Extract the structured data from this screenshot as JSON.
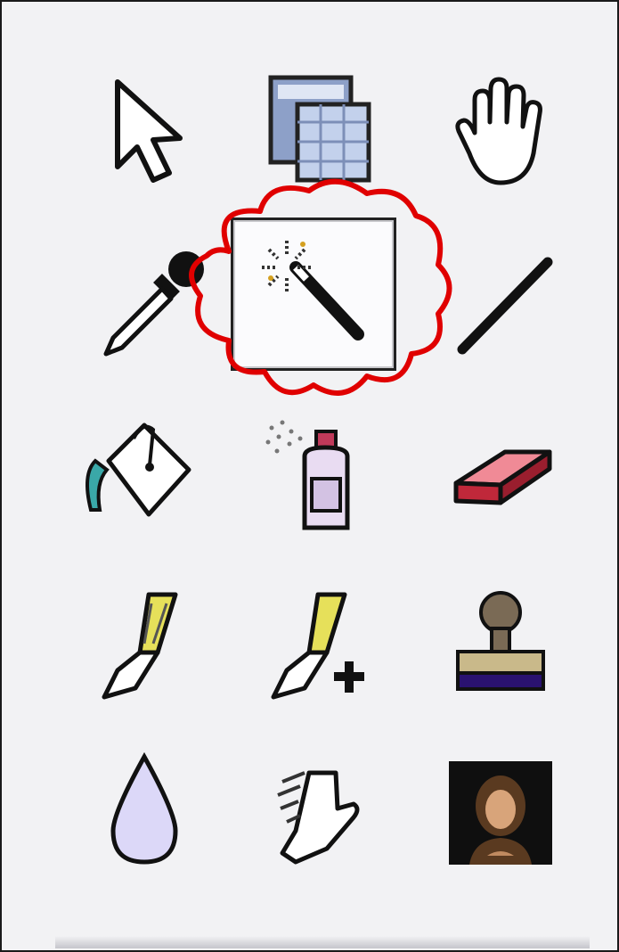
{
  "toolbox": {
    "selected_tool": "magic-wand",
    "tools": [
      [
        "arrow",
        "slice-select",
        "hand"
      ],
      [
        "eyedropper",
        "magic-wand",
        "line"
      ],
      [
        "paint-bucket",
        "spray-can",
        "eraser"
      ],
      [
        "pen",
        "pen-add",
        "stamp"
      ],
      [
        "drop",
        "smudge",
        "photo"
      ]
    ]
  },
  "annotation": {
    "shape": "cloud",
    "color": "#e00000"
  }
}
